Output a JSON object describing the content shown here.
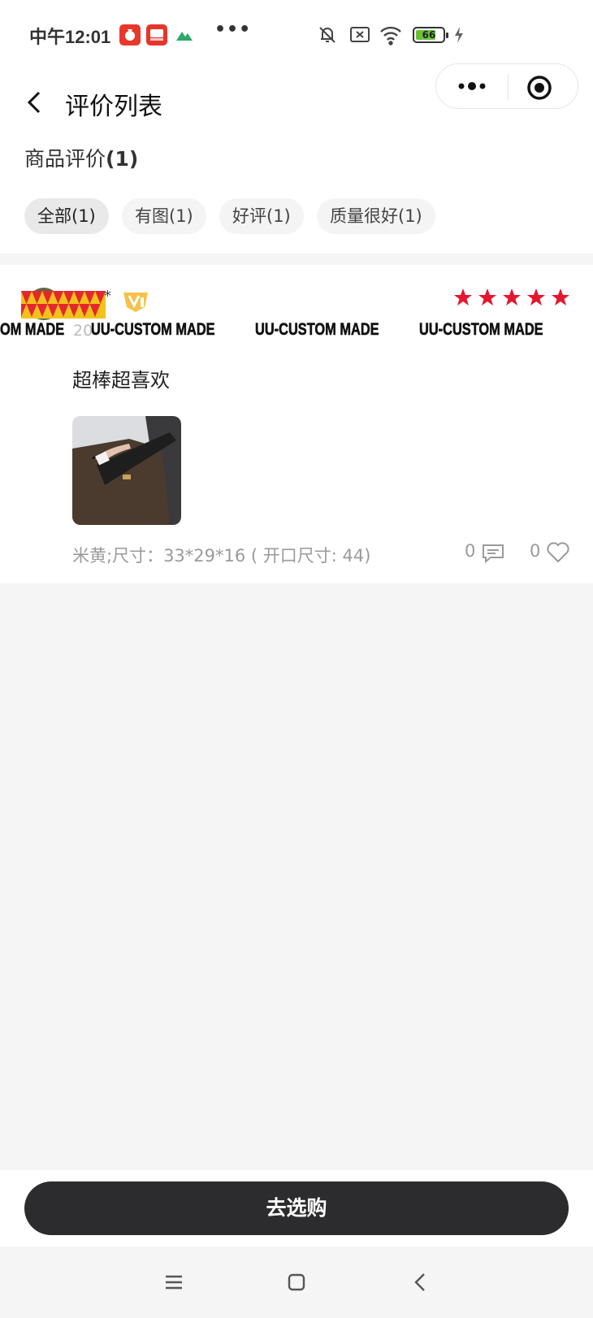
{
  "status_bar": {
    "time": "中午12:01",
    "more_dots": "•••",
    "battery_level": "66"
  },
  "navbar": {
    "title": "评价列表"
  },
  "summary": {
    "label": "商品评价",
    "count": "(1)"
  },
  "filters": [
    {
      "label": "全部(1)",
      "active": true
    },
    {
      "label": "有图(1)",
      "active": false
    },
    {
      "label": "好评(1)",
      "active": false
    },
    {
      "label": "质量很好(1)",
      "active": false
    }
  ],
  "review": {
    "username_tail": "*",
    "rating": 5,
    "date_fragment": "20",
    "watermark": [
      "OM MADE",
      "UU-CUSTOM MADE",
      "UU-CUSTOM MADE",
      "UU-CUSTOM MADE"
    ],
    "text": "超棒超喜欢",
    "spec": "米黄;尺寸：33*29*16 ( 开口尺寸: 44)",
    "comment_count": "0",
    "like_count": "0"
  },
  "bottom": {
    "buy_label": "去选购"
  },
  "colors": {
    "star": "#e5162e",
    "button": "#2c2c2e",
    "vip": "#f2b233"
  }
}
